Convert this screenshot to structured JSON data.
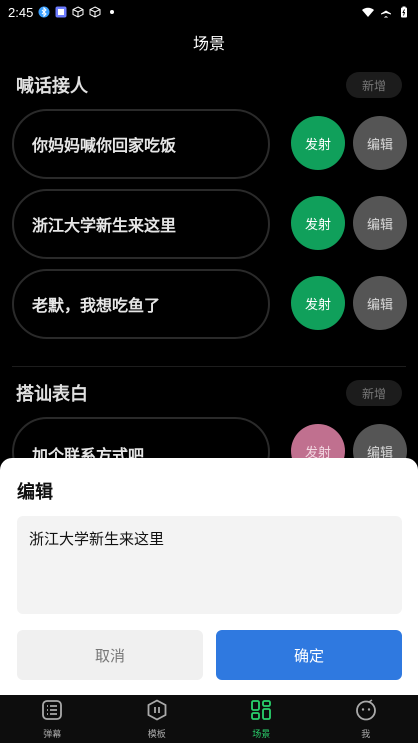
{
  "status_bar": {
    "time": "2:45"
  },
  "header": {
    "title": "场景"
  },
  "sections": [
    {
      "title": "喊话接人",
      "add_label": "新增",
      "items": [
        {
          "text": "你妈妈喊你回家吃饭",
          "fire_label": "发射",
          "edit_label": "编辑"
        },
        {
          "text": "浙江大学新生来这里",
          "fire_label": "发射",
          "edit_label": "编辑"
        },
        {
          "text": "老默，我想吃鱼了",
          "fire_label": "发射",
          "edit_label": "编辑"
        }
      ]
    },
    {
      "title": "搭讪表白",
      "add_label": "新增",
      "items": [
        {
          "text": "加个联系方式吧",
          "fire_label": "发射",
          "edit_label": "编辑"
        }
      ]
    }
  ],
  "dialog": {
    "title": "编辑",
    "text": "浙江大学新生来这里",
    "cancel_label": "取消",
    "confirm_label": "确定"
  },
  "tabs": [
    {
      "label": "弹幕",
      "icon": "list-icon",
      "active": false
    },
    {
      "label": "模板",
      "icon": "template-icon",
      "active": false
    },
    {
      "label": "场景",
      "icon": "grid-icon",
      "active": true
    },
    {
      "label": "我",
      "icon": "profile-icon",
      "active": false
    }
  ],
  "colors": {
    "fire_green": "#10a05b",
    "fire_pink": "#c0708f",
    "edit_gray": "#555555",
    "confirm_blue": "#2f79e0",
    "tab_active": "#2ad36d"
  }
}
